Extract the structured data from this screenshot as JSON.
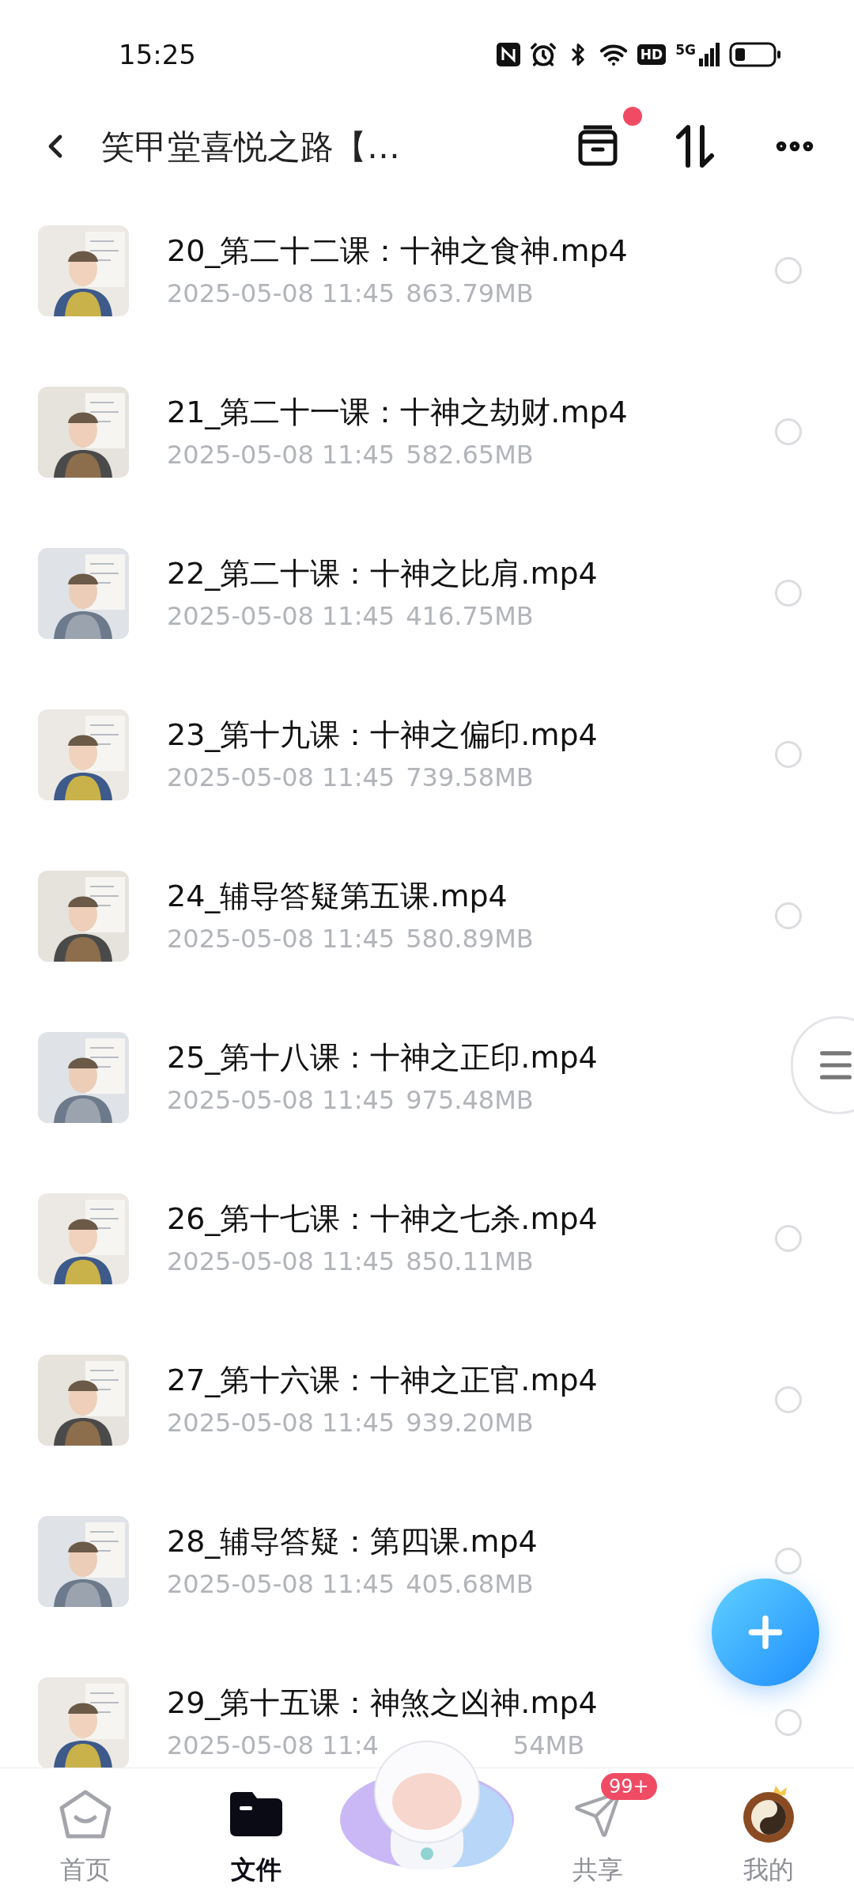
{
  "status_bar": {
    "time": "15:25",
    "hd": "HD",
    "network": "5G"
  },
  "header": {
    "title": "笑甲堂喜悦之路【…",
    "notification_dot": true
  },
  "files": [
    {
      "kind": "file",
      "name": "20_第二十二课：十神之食神.mp4",
      "date": "2025-05-08",
      "time": "11:45",
      "size": "863.79MB",
      "selected": false
    },
    {
      "kind": "file",
      "name": "21_第二十一课：十神之劫财.mp4",
      "date": "2025-05-08",
      "time": "11:45",
      "size": "582.65MB",
      "selected": false
    },
    {
      "kind": "file",
      "name": "22_第二十课：十神之比肩.mp4",
      "date": "2025-05-08",
      "time": "11:45",
      "size": "416.75MB",
      "selected": false
    },
    {
      "kind": "file",
      "name": "23_第十九课：十神之偏印.mp4",
      "date": "2025-05-08",
      "time": "11:45",
      "size": "739.58MB",
      "selected": false
    },
    {
      "kind": "file",
      "name": "24_辅导答疑第五课.mp4",
      "date": "2025-05-08",
      "time": "11:45",
      "size": "580.89MB",
      "selected": false
    },
    {
      "kind": "file",
      "name": "25_第十八课：十神之正印.mp4",
      "date": "2025-05-08",
      "time": "11:45",
      "size": "975.48MB"
    },
    {
      "kind": "file",
      "name": "26_第十七课：十神之七杀.mp4",
      "date": "2025-05-08",
      "time": "11:45",
      "size": "850.11MB",
      "selected": false
    },
    {
      "kind": "file",
      "name": "27_第十六课：十神之正官.mp4",
      "date": "2025-05-08",
      "time": "11:45",
      "size": "939.20MB",
      "selected": false
    },
    {
      "kind": "file",
      "name": "28_辅导答疑：第四课.mp4",
      "date": "2025-05-08",
      "time": "11:45",
      "size": "405.68MB",
      "selected": false
    },
    {
      "kind": "covered",
      "name": "29_第十五课：神煞之凶神.mp4",
      "date": "2025-05-08",
      "time": "11:4",
      "size": "54MB",
      "selected": false
    }
  ],
  "bottom_nav": [
    {
      "kind": "home",
      "label": "首页",
      "selected": false
    },
    {
      "kind": "files",
      "label": "文件",
      "selected": true
    },
    {
      "kind": "assistant"
    },
    {
      "kind": "share",
      "label": "共享",
      "selected": false,
      "badge": "99+"
    },
    {
      "kind": "me",
      "label": "我的",
      "selected": false
    }
  ]
}
